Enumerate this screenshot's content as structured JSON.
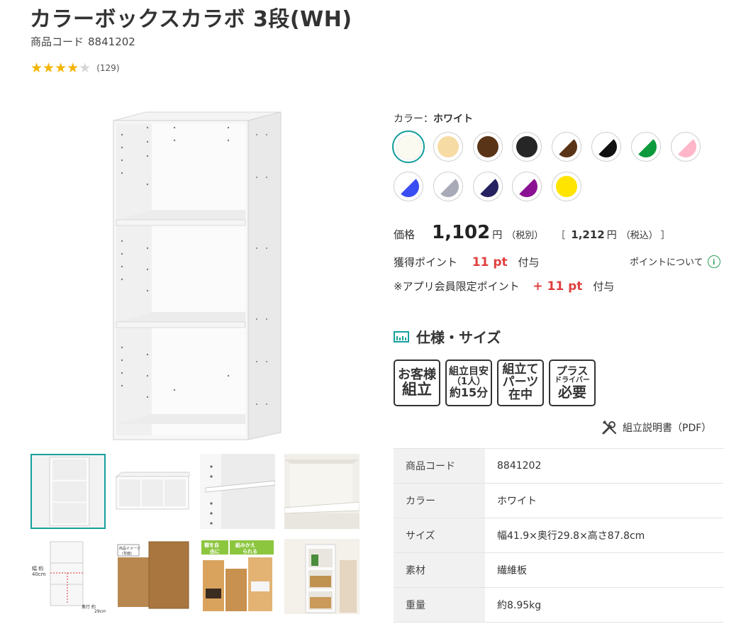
{
  "product": {
    "title": "カラーボックスカラボ 3段(WH)",
    "code_label": "商品コード",
    "code": "8841202",
    "rating_value": 4,
    "rating_max": 5,
    "review_count": "(129)"
  },
  "color": {
    "label": "カラー：",
    "selected": "ホワイト",
    "swatches": [
      {
        "name": "white",
        "colors": [
          "#fbfaf0"
        ]
      },
      {
        "name": "natural",
        "colors": [
          "#f7dba4"
        ]
      },
      {
        "name": "brown",
        "colors": [
          "#5a3417"
        ]
      },
      {
        "name": "black",
        "colors": [
          "#262626"
        ]
      },
      {
        "name": "brown-white",
        "colors": [
          "#5a3417",
          "#ffffff"
        ]
      },
      {
        "name": "black-white",
        "colors": [
          "#111111",
          "#ffffff"
        ]
      },
      {
        "name": "green-white",
        "colors": [
          "#0c9a3c",
          "#ffffff"
        ]
      },
      {
        "name": "pink-white",
        "colors": [
          "#ffb6c8",
          "#ffffff"
        ]
      },
      {
        "name": "blue-white",
        "colors": [
          "#3a4df2",
          "#ffffff"
        ]
      },
      {
        "name": "gray-white",
        "colors": [
          "#a8aab8",
          "#ffffff"
        ]
      },
      {
        "name": "navy-white",
        "colors": [
          "#262160",
          "#ffffff"
        ]
      },
      {
        "name": "purple-white",
        "colors": [
          "#8a1192",
          "#ffffff"
        ]
      },
      {
        "name": "yellow",
        "colors": [
          "#ffe400"
        ]
      }
    ]
  },
  "price": {
    "label": "価格",
    "value": "1,102",
    "yen": "円",
    "tax_note": "（税別）",
    "bracket_open": "［",
    "tax_in_value": "1,212",
    "tax_in_yen": "円",
    "tax_in_note": "（税込）",
    "bracket_close": "］"
  },
  "points": {
    "earned_label": "獲得ポイント",
    "earned_value": "11 pt",
    "earned_suffix": "付与",
    "about_link": "ポイントについて",
    "app_label": "※アプリ会員限定ポイント",
    "app_value": "+ 11 pt",
    "app_suffix": "付与"
  },
  "spec": {
    "heading": "仕様・サイズ",
    "badges": [
      {
        "lines": [
          "お客様",
          "組立"
        ]
      },
      {
        "lines": [
          "組立目安",
          "（1人）",
          "約15分"
        ]
      },
      {
        "lines": [
          "組立て",
          "パーツ",
          "在中"
        ]
      },
      {
        "lines": [
          "プラス",
          "ドライバー",
          "必要"
        ]
      }
    ],
    "manual_link": "組立説明書（PDF）",
    "rows": [
      {
        "key": "商品コード",
        "value": "8841202"
      },
      {
        "key": "カラー",
        "value": "ホワイト"
      },
      {
        "key": "サイズ",
        "value": "幅41.9×奥行29.8×高さ87.8cm"
      },
      {
        "key": "素材",
        "value": "繊維板"
      },
      {
        "key": "重量",
        "value": "約8.95kg"
      }
    ]
  },
  "thumbnails": {
    "count": 8,
    "selected_index": 0,
    "dimension_labels": [
      "幅 約",
      "40cm",
      "奥行 約",
      "29cm"
    ],
    "image_note_label": "商品イメージ",
    "image_note_sub": "(背面)",
    "banner_words": [
      "棚を自",
      "由に",
      "組みかえ",
      "られる"
    ]
  }
}
